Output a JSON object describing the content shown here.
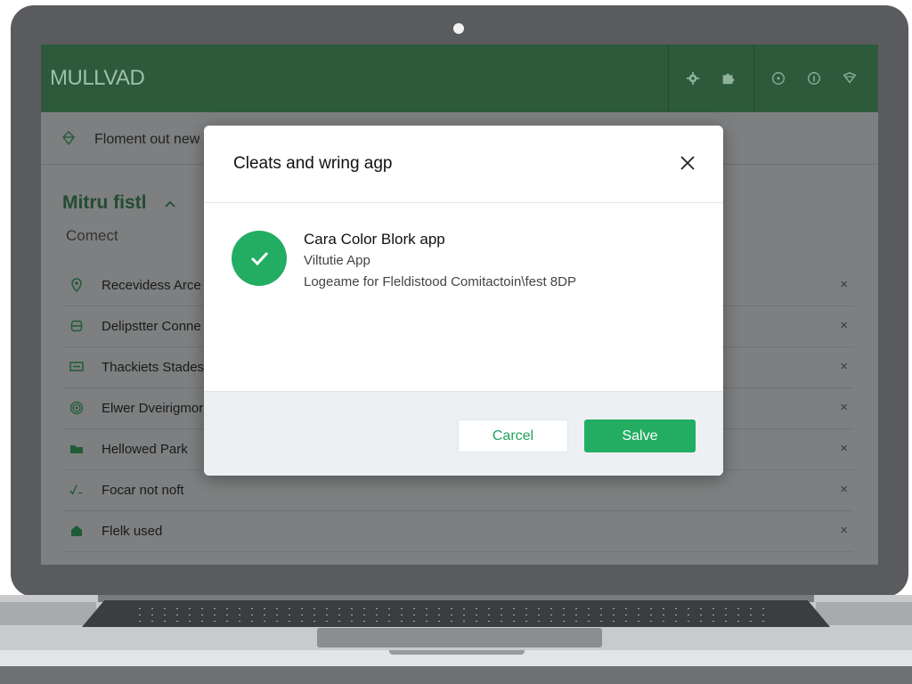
{
  "app": {
    "logo_text": "MULLVAD",
    "header_icons": [
      "gear-icon",
      "puzzle-icon",
      "alert-circle-icon",
      "info-icon",
      "shield-icon"
    ]
  },
  "subbar": {
    "text": "Floment out new"
  },
  "section": {
    "title": "Mitru fistl",
    "subtitle": "Comect"
  },
  "list": {
    "items": [
      {
        "label": "Recevidess Arce",
        "icon": "pin-icon"
      },
      {
        "label": "Delipstter Conne",
        "icon": "device-icon"
      },
      {
        "label": "Thackiets Stades",
        "icon": "panel-icon"
      },
      {
        "label": "Elwer Dveirigmor",
        "icon": "spiral-icon"
      },
      {
        "label": "Hellowed Park",
        "icon": "folder-icon"
      },
      {
        "label": "Focar not noft",
        "icon": "check-sqrt-icon"
      },
      {
        "label": "Flelk used",
        "icon": "home-icon"
      }
    ],
    "remove_glyph": "×"
  },
  "modal": {
    "title": "Cleats and wring agp",
    "close_icon": "close-icon",
    "app_name": "Cara Color Blork app",
    "app_type": "Viltutie App",
    "app_description": "Logeame for Fleldistood Comitactoin\\fest 8DP",
    "cancel_label": "Carcel",
    "save_label": "Salve"
  },
  "colors": {
    "header_green": "#2c5a3b",
    "accent_green": "#23ad62"
  }
}
